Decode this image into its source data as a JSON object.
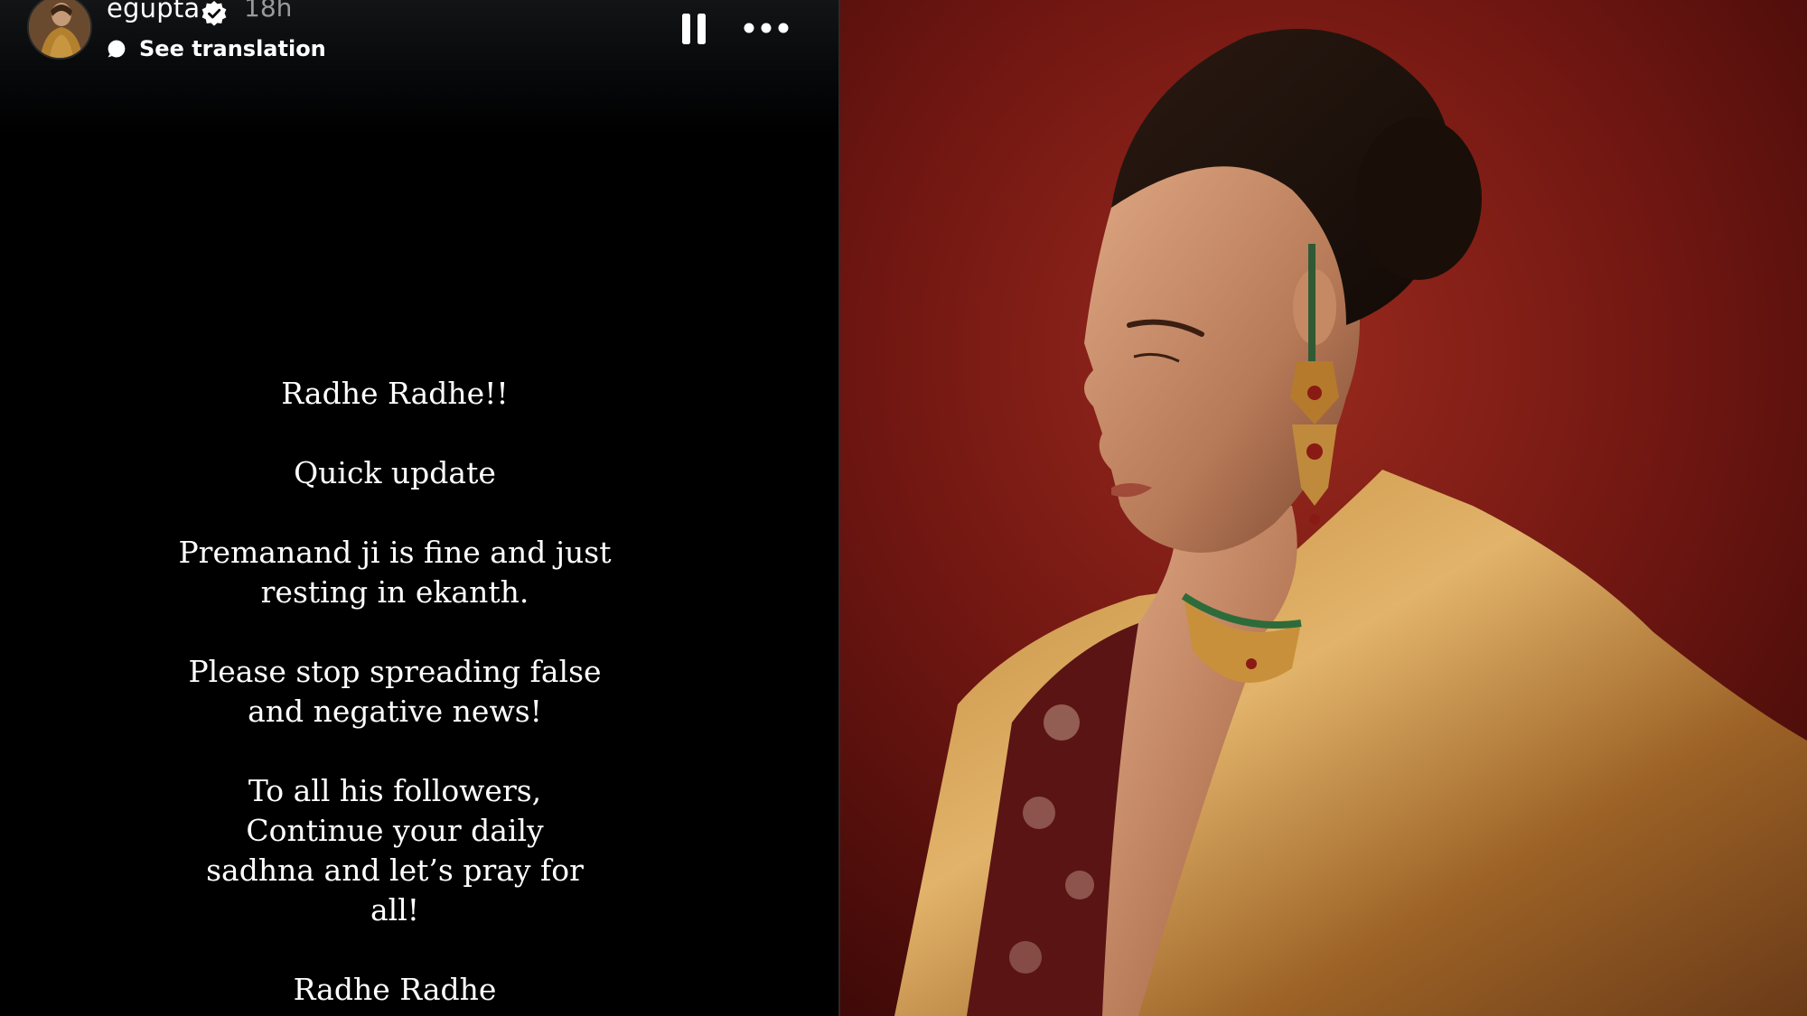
{
  "story": {
    "username": "egupta",
    "timestamp": "18h",
    "translation_label": "See translation",
    "lines": [
      "Radhe Radhe!!",
      "Quick update",
      "Premanand ji is fine and just resting in ekanth.",
      "Please stop spreading false and negative news!",
      "To all his followers, Continue your daily sadhna and let’s pray for all!",
      "Radhe Radhe"
    ]
  },
  "icons": {
    "verified": "verified-badge-icon",
    "translation": "translate-icon",
    "pause": "pause-icon",
    "more": "more-options-icon"
  },
  "colors": {
    "story_background": "#000000",
    "text": "#ffffff",
    "timestamp": "#9a9a9a",
    "photo_background": "#6e1512",
    "saree_gold": "#b07a2e"
  }
}
